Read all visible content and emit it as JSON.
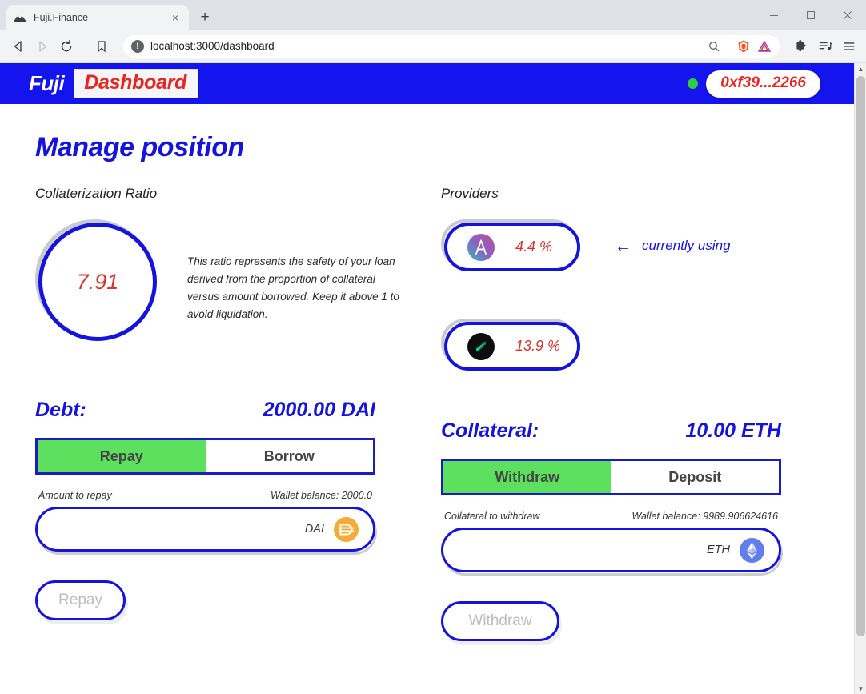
{
  "browser": {
    "tab": {
      "title": "Fuji.Finance",
      "favicon": "mountain-favicon",
      "close": "×"
    },
    "new_tab": "+",
    "window_controls": {
      "minimize": "—",
      "maximize": "□",
      "close": "✕"
    },
    "nav": {
      "back": "◁",
      "forward": "▷",
      "reload": "↻",
      "bookmark": "bookmark-icon"
    },
    "url": {
      "value": "localhost:3000/dashboard",
      "info_glyph": "!",
      "zoom_icon": "search-icon"
    },
    "toolbar_icons": [
      "brave-lion-icon",
      "brave-rewards-triangle-icon",
      "extensions-puzzle-icon",
      "playlist-icon",
      "menu-hamburger-icon"
    ]
  },
  "app": {
    "brand_name": "Fuji",
    "page_tag": "Dashboard",
    "wallet": {
      "address": "0xf39...2266",
      "status": "connected"
    },
    "title": "Manage position",
    "colors": {
      "brand_blue": "#1414dd",
      "accent_red": "#d8342b",
      "active_green": "#5de05d",
      "status_green": "#2ecc40"
    }
  },
  "collateralization": {
    "label": "Collaterization Ratio",
    "ratio": "7.91",
    "description": "This ratio represents the safety of your loan derived from the proportion of collateral versus amount borrowed. Keep it above 1 to avoid liquidation."
  },
  "providers": {
    "label": "Providers",
    "currently_using_note": "currently using",
    "arrow": "←",
    "items": [
      {
        "name": "aave",
        "logo": "aave-logo-icon",
        "rate": "4.4 %",
        "active": true
      },
      {
        "name": "compound",
        "logo": "compound-logo-icon",
        "rate": "13.9 %",
        "active": false
      }
    ]
  },
  "debt": {
    "heading": "Debt:",
    "amount": "2000.00 DAI",
    "tabs": [
      {
        "label": "Repay",
        "active": true
      },
      {
        "label": "Borrow",
        "active": false
      }
    ],
    "input_label": "Amount to repay",
    "wallet_balance": "Wallet balance: 2000.0",
    "input_value": "",
    "input_placeholder": "",
    "token_symbol": "DAI",
    "token_logo": "dai-logo-icon",
    "action_label": "Repay"
  },
  "collateral": {
    "heading": "Collateral:",
    "amount": "10.00 ETH",
    "tabs": [
      {
        "label": "Withdraw",
        "active": true
      },
      {
        "label": "Deposit",
        "active": false
      }
    ],
    "input_label": "Collateral to withdraw",
    "wallet_balance": "Wallet balance: 9989.906624616",
    "input_value": "",
    "input_placeholder": "",
    "token_symbol": "ETH",
    "token_logo": "eth-logo-icon",
    "action_label": "Withdraw"
  },
  "scrollbar": {
    "up": "▲",
    "down": "▼"
  }
}
